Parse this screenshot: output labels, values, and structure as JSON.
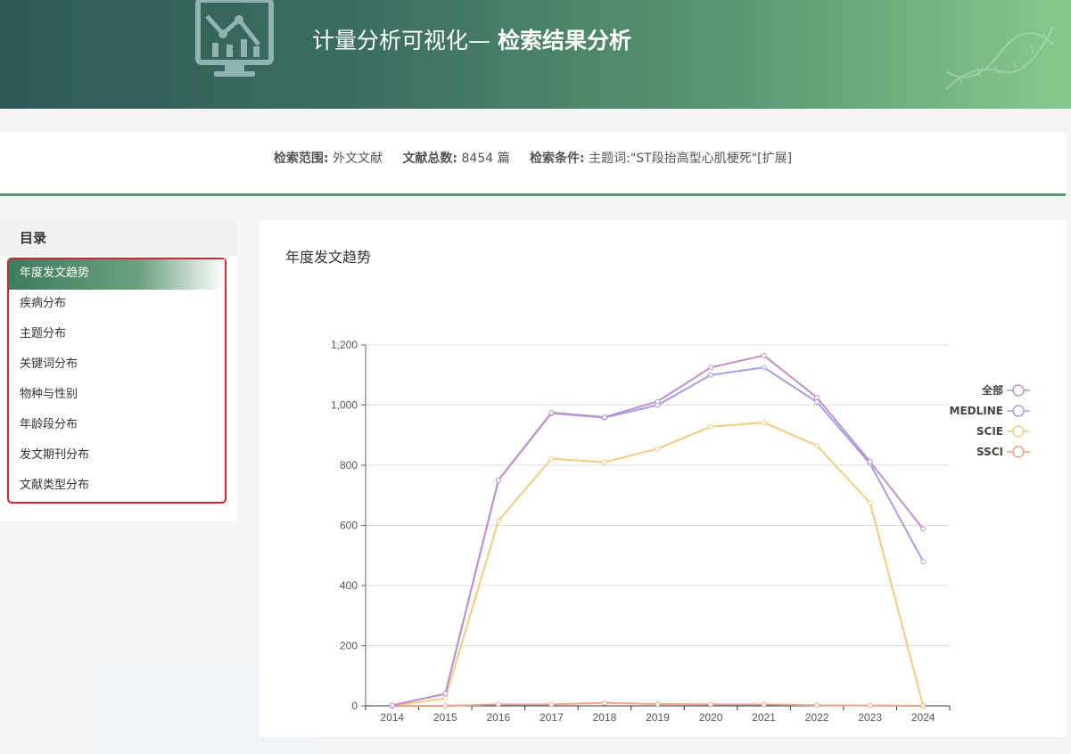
{
  "header": {
    "title_prefix": "计量分析可视化— ",
    "title_bold": "检索结果分析",
    "logo_icon": "monitor-chart-icon"
  },
  "info": {
    "scope_label": "检索范围:",
    "scope_value": "外文文献",
    "total_label": "文献总数:",
    "total_value": "8454 篇",
    "cond_label": "检索条件:",
    "cond_value": "主题词:\"ST段抬高型心肌梗死\"[扩展]"
  },
  "sidebar": {
    "heading": "目录",
    "items": [
      {
        "label": "年度发文趋势",
        "active": true
      },
      {
        "label": "疾病分布"
      },
      {
        "label": "主题分布"
      },
      {
        "label": "关键词分布"
      },
      {
        "label": "物种与性别"
      },
      {
        "label": "年龄段分布"
      },
      {
        "label": "发文期刊分布"
      },
      {
        "label": "文献类型分布"
      }
    ]
  },
  "panel": {
    "title": "年度发文趋势"
  },
  "chart_data": {
    "type": "line",
    "title": "年度发文趋势",
    "xlabel": "",
    "ylabel": "",
    "x": [
      2014,
      2015,
      2016,
      2017,
      2018,
      2019,
      2020,
      2021,
      2022,
      2023,
      2024
    ],
    "ylim": [
      0,
      1200
    ],
    "yticks": [
      0,
      200,
      400,
      600,
      800,
      1000,
      1200
    ],
    "ytick_labels": [
      "0",
      "200",
      "400",
      "600",
      "800",
      "1,000",
      "1,200"
    ],
    "grid": true,
    "legend_position": "right",
    "series": [
      {
        "name": "全部",
        "color": "#c090c8",
        "values": [
          2,
          40,
          750,
          975,
          960,
          1012,
          1125,
          1165,
          1025,
          812,
          588
        ]
      },
      {
        "name": "MEDLINE",
        "color": "#a0a0e8",
        "values": [
          2,
          40,
          750,
          973,
          958,
          1000,
          1100,
          1125,
          1010,
          805,
          480
        ]
      },
      {
        "name": "SCIE",
        "color": "#f0cc80",
        "values": [
          0,
          25,
          615,
          822,
          810,
          855,
          928,
          942,
          865,
          675,
          0
        ]
      },
      {
        "name": "SSCI",
        "color": "#f0a080",
        "values": [
          0,
          0,
          5,
          5,
          10,
          6,
          5,
          5,
          2,
          1,
          0
        ]
      }
    ]
  }
}
